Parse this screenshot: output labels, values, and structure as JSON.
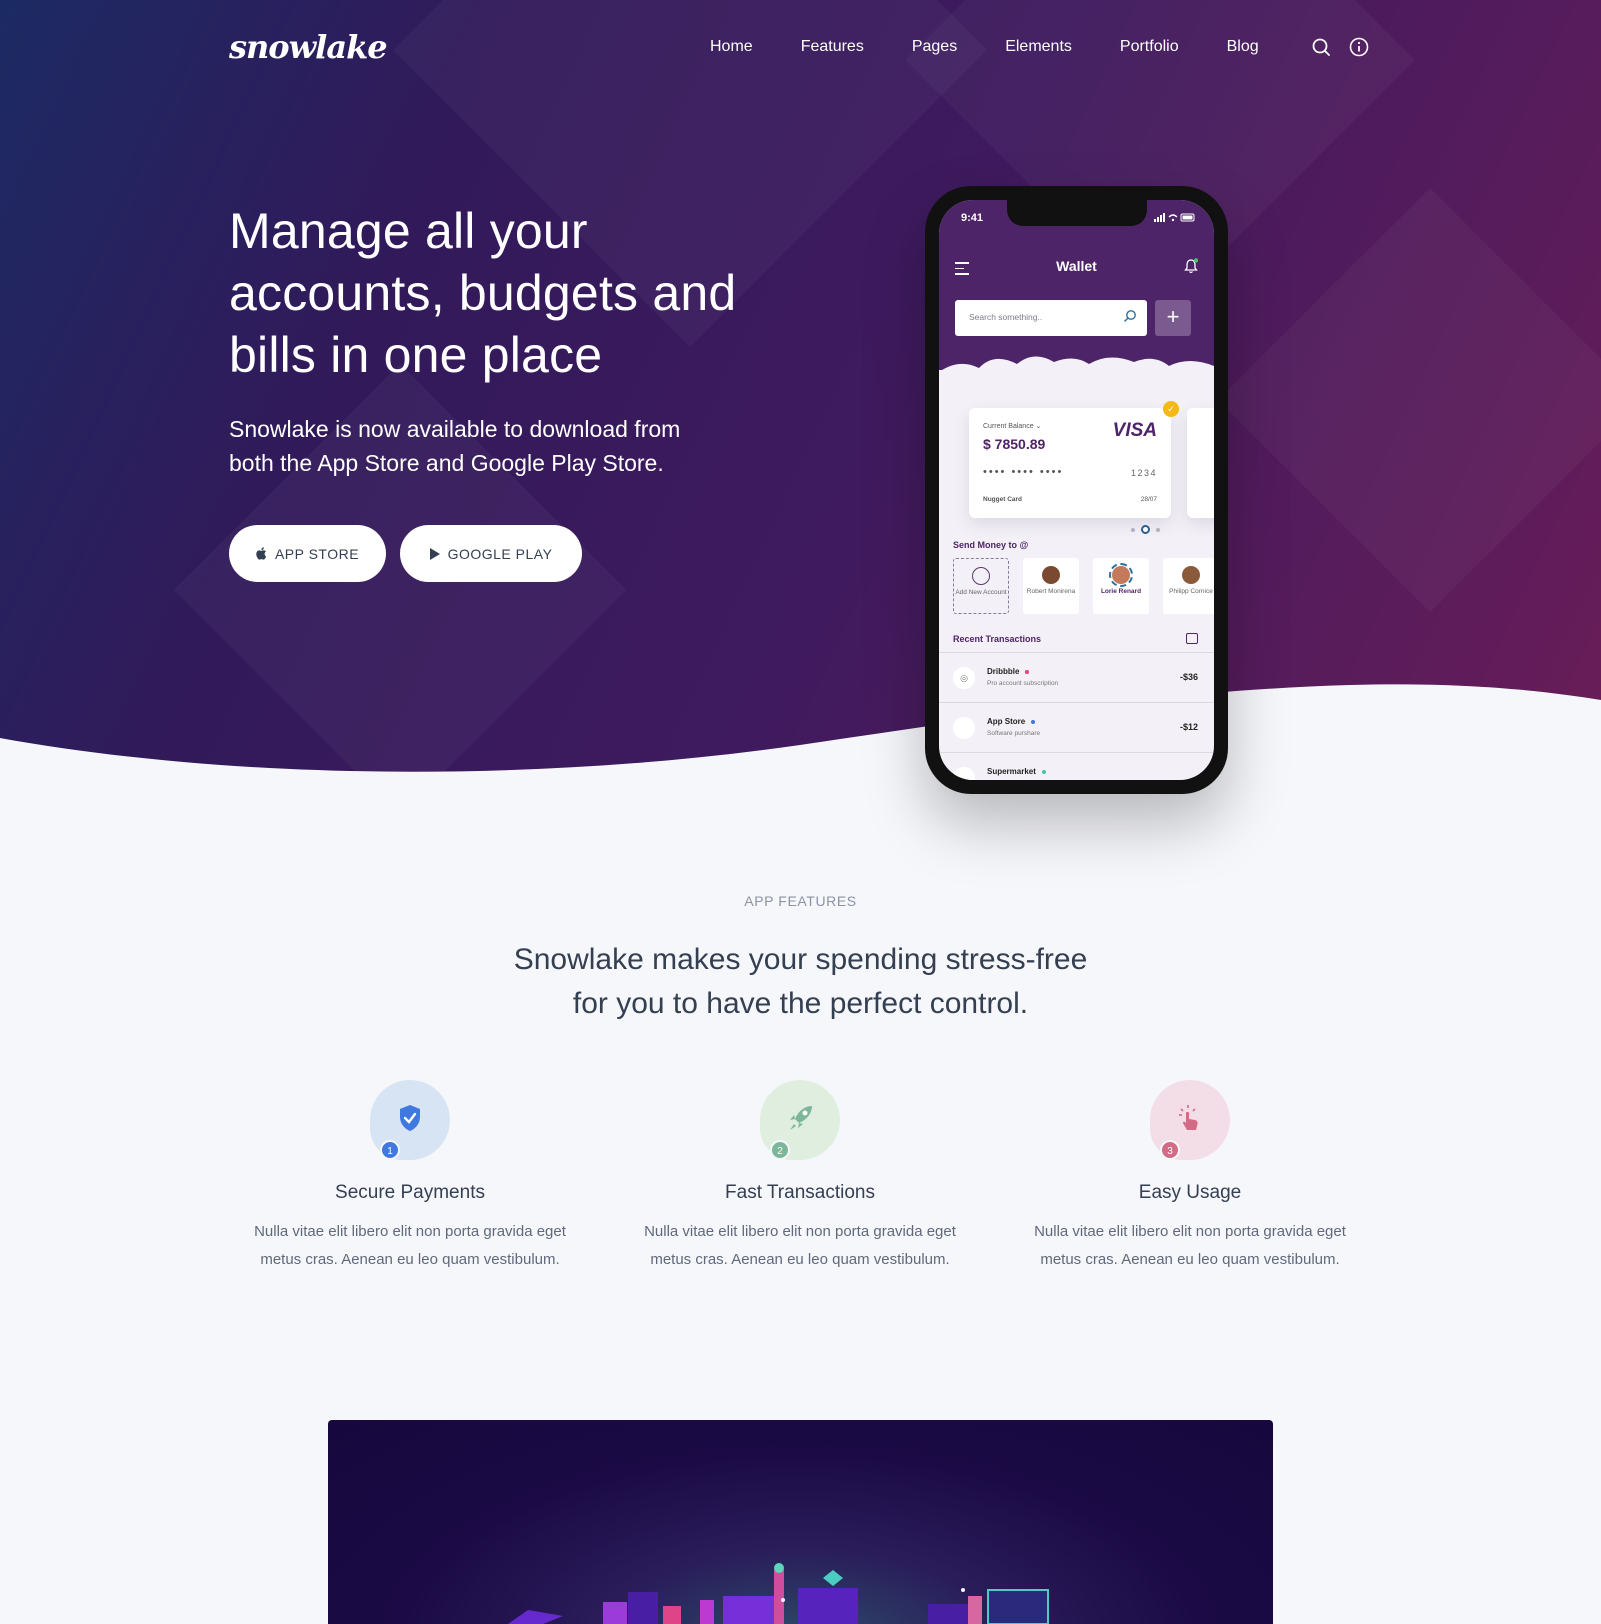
{
  "brand": {
    "logo_text": "snowlake"
  },
  "nav": {
    "links": [
      "Home",
      "Features",
      "Pages",
      "Elements",
      "Portfolio",
      "Blog"
    ],
    "icons": [
      "search-icon",
      "info-icon"
    ]
  },
  "hero": {
    "title": "Manage all your accounts, budgets and bills in one place",
    "subtitle": "Snowlake is now available to download from both the App Store and Google Play Store.",
    "buttons": [
      {
        "label": "APP STORE",
        "icon": "apple-icon"
      },
      {
        "label": "GOOGLE PLAY",
        "icon": "play-icon"
      }
    ]
  },
  "phone": {
    "time": "9:41",
    "title": "Wallet",
    "search_placeholder": "Search something..",
    "card": {
      "balance_label": "Current Balance ⌄",
      "balance": "$ 7850.89",
      "brand": "VISA",
      "masked": "•••• •••• ••••",
      "last4": "1234",
      "name": "Nugget Card",
      "expiry": "28/07"
    },
    "send_money_label": "Send Money to @",
    "contacts": [
      {
        "name": "Add New Account"
      },
      {
        "name": "Robert Monirena"
      },
      {
        "name": "Lorie Renard"
      },
      {
        "name": "Philipp Cornice"
      }
    ],
    "recent_label": "Recent Transactions",
    "transactions": [
      {
        "name": "Dribbble",
        "desc": "Pro account subscription",
        "amount": "-$36",
        "dot_color": "#e2407f"
      },
      {
        "name": "App Store",
        "desc": "Software purshare",
        "amount": "-$12",
        "dot_color": "#3f78e0"
      },
      {
        "name": "Supermarket",
        "desc": "",
        "amount": "",
        "dot_color": "#45c4a0"
      }
    ]
  },
  "features": {
    "kicker": "APP FEATURES",
    "title_line1": "Snowlake makes your spending stress-free",
    "title_line2": "for you to have the perfect control.",
    "items": [
      {
        "num": "1",
        "title": "Secure Payments",
        "line1": "Nulla vitae elit libero elit non porta gravida eget",
        "line2": "metus cras. Aenean eu leo quam vestibulum.",
        "color": "#3f78e0",
        "bg": "#d6e4f3",
        "icon": "shield-check-icon"
      },
      {
        "num": "2",
        "title": "Fast Transactions",
        "line1": "Nulla vitae elit libero elit non porta gravida eget",
        "line2": "metus cras. Aenean eu leo quam vestibulum.",
        "color": "#7cb798",
        "bg": "#dfeedf",
        "icon": "rocket-icon"
      },
      {
        "num": "3",
        "title": "Easy Usage",
        "line1": "Nulla vitae elit libero elit non porta gravida eget",
        "line2": "metus cras. Aenean eu leo quam vestibulum.",
        "color": "#d16b86",
        "bg": "#f3dde6",
        "icon": "tap-icon"
      }
    ]
  }
}
